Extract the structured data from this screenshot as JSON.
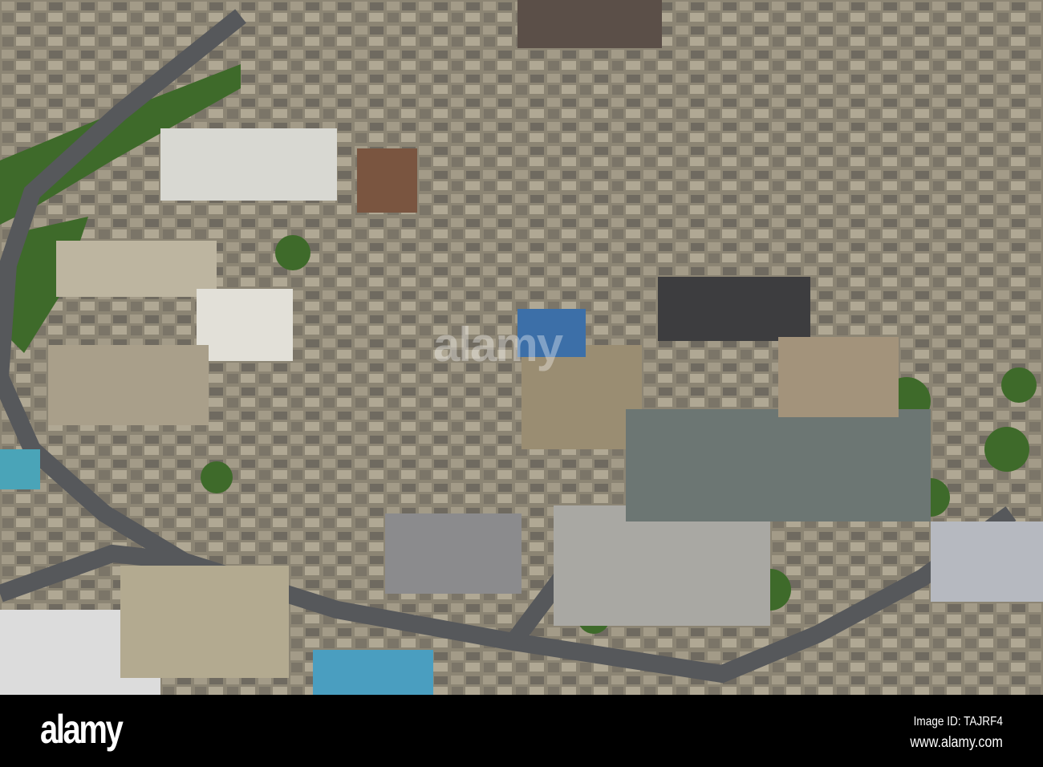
{
  "photo": {
    "subject": "aerial-city-view",
    "watermark": "alamy",
    "colors": {
      "buildings": "#8f8878",
      "roads": "#55575a",
      "trees": "#3f6b2a",
      "roofs": "#6d6f6c"
    }
  },
  "banner": {
    "logo": "alamy",
    "image_id": "Image ID: TAJRF4",
    "website": "www.alamy.com"
  }
}
